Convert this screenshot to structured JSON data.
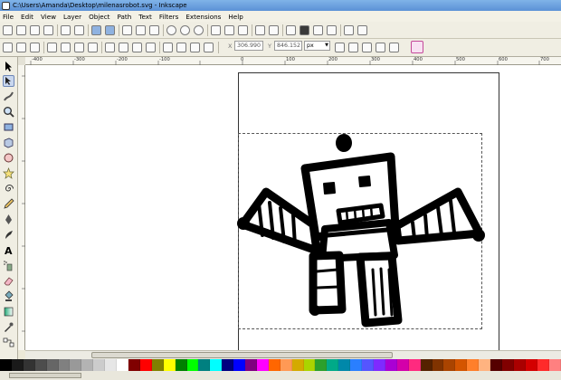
{
  "window": {
    "title": "C:\\Users\\Amanda\\Desktop\\milenasrobot.svg - Inkscape"
  },
  "menu": {
    "items": [
      "File",
      "Edit",
      "View",
      "Layer",
      "Object",
      "Path",
      "Text",
      "Filters",
      "Extensions",
      "Help"
    ]
  },
  "toolbar": {
    "x_label": "X",
    "x_value": "306.990",
    "y_label": "Y",
    "y_value": "846.152",
    "unit": "px"
  },
  "ruler": {
    "top_labels": [
      "-400",
      "-300",
      "-200",
      "-100",
      "0",
      "100",
      "200",
      "300",
      "400",
      "500",
      "600",
      "700",
      "800",
      "900"
    ]
  },
  "palette": {
    "colors": [
      "#000000",
      "#1a1a1a",
      "#333333",
      "#4d4d4d",
      "#666666",
      "#808080",
      "#999999",
      "#b3b3b3",
      "#cccccc",
      "#e6e6e6",
      "#ffffff",
      "#800000",
      "#ff0000",
      "#808000",
      "#ffff00",
      "#008000",
      "#00ff00",
      "#008080",
      "#00ffff",
      "#000080",
      "#0000ff",
      "#800080",
      "#ff00ff",
      "#ff6600",
      "#ff9955",
      "#d4aa00",
      "#aad400",
      "#2ca02c",
      "#00aa88",
      "#0088aa",
      "#2a7fff",
      "#5555ff",
      "#7f2aff",
      "#aa00d4",
      "#d400aa",
      "#ff2a7f",
      "#552200",
      "#803300",
      "#aa4400",
      "#d45500",
      "#ff7f2a",
      "#ffb380",
      "#550000",
      "#800000",
      "#aa0000",
      "#d40000",
      "#ff2a2a",
      "#ff8080"
    ]
  }
}
